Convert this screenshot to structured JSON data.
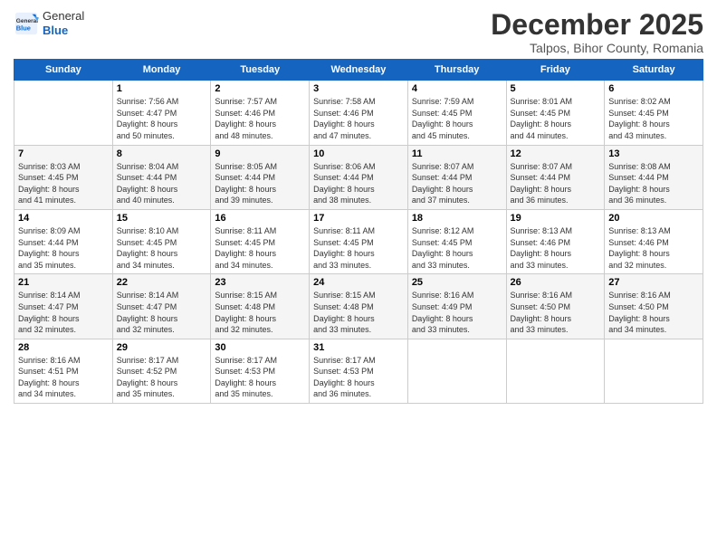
{
  "header": {
    "logo_general": "General",
    "logo_blue": "Blue",
    "main_title": "December 2025",
    "subtitle": "Talpos, Bihor County, Romania"
  },
  "calendar": {
    "days_of_week": [
      "Sunday",
      "Monday",
      "Tuesday",
      "Wednesday",
      "Thursday",
      "Friday",
      "Saturday"
    ],
    "weeks": [
      [
        {
          "day": "",
          "info": ""
        },
        {
          "day": "1",
          "info": "Sunrise: 7:56 AM\nSunset: 4:47 PM\nDaylight: 8 hours\nand 50 minutes."
        },
        {
          "day": "2",
          "info": "Sunrise: 7:57 AM\nSunset: 4:46 PM\nDaylight: 8 hours\nand 48 minutes."
        },
        {
          "day": "3",
          "info": "Sunrise: 7:58 AM\nSunset: 4:46 PM\nDaylight: 8 hours\nand 47 minutes."
        },
        {
          "day": "4",
          "info": "Sunrise: 7:59 AM\nSunset: 4:45 PM\nDaylight: 8 hours\nand 45 minutes."
        },
        {
          "day": "5",
          "info": "Sunrise: 8:01 AM\nSunset: 4:45 PM\nDaylight: 8 hours\nand 44 minutes."
        },
        {
          "day": "6",
          "info": "Sunrise: 8:02 AM\nSunset: 4:45 PM\nDaylight: 8 hours\nand 43 minutes."
        }
      ],
      [
        {
          "day": "7",
          "info": "Sunrise: 8:03 AM\nSunset: 4:45 PM\nDaylight: 8 hours\nand 41 minutes."
        },
        {
          "day": "8",
          "info": "Sunrise: 8:04 AM\nSunset: 4:44 PM\nDaylight: 8 hours\nand 40 minutes."
        },
        {
          "day": "9",
          "info": "Sunrise: 8:05 AM\nSunset: 4:44 PM\nDaylight: 8 hours\nand 39 minutes."
        },
        {
          "day": "10",
          "info": "Sunrise: 8:06 AM\nSunset: 4:44 PM\nDaylight: 8 hours\nand 38 minutes."
        },
        {
          "day": "11",
          "info": "Sunrise: 8:07 AM\nSunset: 4:44 PM\nDaylight: 8 hours\nand 37 minutes."
        },
        {
          "day": "12",
          "info": "Sunrise: 8:07 AM\nSunset: 4:44 PM\nDaylight: 8 hours\nand 36 minutes."
        },
        {
          "day": "13",
          "info": "Sunrise: 8:08 AM\nSunset: 4:44 PM\nDaylight: 8 hours\nand 36 minutes."
        }
      ],
      [
        {
          "day": "14",
          "info": "Sunrise: 8:09 AM\nSunset: 4:44 PM\nDaylight: 8 hours\nand 35 minutes."
        },
        {
          "day": "15",
          "info": "Sunrise: 8:10 AM\nSunset: 4:45 PM\nDaylight: 8 hours\nand 34 minutes."
        },
        {
          "day": "16",
          "info": "Sunrise: 8:11 AM\nSunset: 4:45 PM\nDaylight: 8 hours\nand 34 minutes."
        },
        {
          "day": "17",
          "info": "Sunrise: 8:11 AM\nSunset: 4:45 PM\nDaylight: 8 hours\nand 33 minutes."
        },
        {
          "day": "18",
          "info": "Sunrise: 8:12 AM\nSunset: 4:45 PM\nDaylight: 8 hours\nand 33 minutes."
        },
        {
          "day": "19",
          "info": "Sunrise: 8:13 AM\nSunset: 4:46 PM\nDaylight: 8 hours\nand 33 minutes."
        },
        {
          "day": "20",
          "info": "Sunrise: 8:13 AM\nSunset: 4:46 PM\nDaylight: 8 hours\nand 32 minutes."
        }
      ],
      [
        {
          "day": "21",
          "info": "Sunrise: 8:14 AM\nSunset: 4:47 PM\nDaylight: 8 hours\nand 32 minutes."
        },
        {
          "day": "22",
          "info": "Sunrise: 8:14 AM\nSunset: 4:47 PM\nDaylight: 8 hours\nand 32 minutes."
        },
        {
          "day": "23",
          "info": "Sunrise: 8:15 AM\nSunset: 4:48 PM\nDaylight: 8 hours\nand 32 minutes."
        },
        {
          "day": "24",
          "info": "Sunrise: 8:15 AM\nSunset: 4:48 PM\nDaylight: 8 hours\nand 33 minutes."
        },
        {
          "day": "25",
          "info": "Sunrise: 8:16 AM\nSunset: 4:49 PM\nDaylight: 8 hours\nand 33 minutes."
        },
        {
          "day": "26",
          "info": "Sunrise: 8:16 AM\nSunset: 4:50 PM\nDaylight: 8 hours\nand 33 minutes."
        },
        {
          "day": "27",
          "info": "Sunrise: 8:16 AM\nSunset: 4:50 PM\nDaylight: 8 hours\nand 34 minutes."
        }
      ],
      [
        {
          "day": "28",
          "info": "Sunrise: 8:16 AM\nSunset: 4:51 PM\nDaylight: 8 hours\nand 34 minutes."
        },
        {
          "day": "29",
          "info": "Sunrise: 8:17 AM\nSunset: 4:52 PM\nDaylight: 8 hours\nand 35 minutes."
        },
        {
          "day": "30",
          "info": "Sunrise: 8:17 AM\nSunset: 4:53 PM\nDaylight: 8 hours\nand 35 minutes."
        },
        {
          "day": "31",
          "info": "Sunrise: 8:17 AM\nSunset: 4:53 PM\nDaylight: 8 hours\nand 36 minutes."
        },
        {
          "day": "",
          "info": ""
        },
        {
          "day": "",
          "info": ""
        },
        {
          "day": "",
          "info": ""
        }
      ]
    ]
  }
}
